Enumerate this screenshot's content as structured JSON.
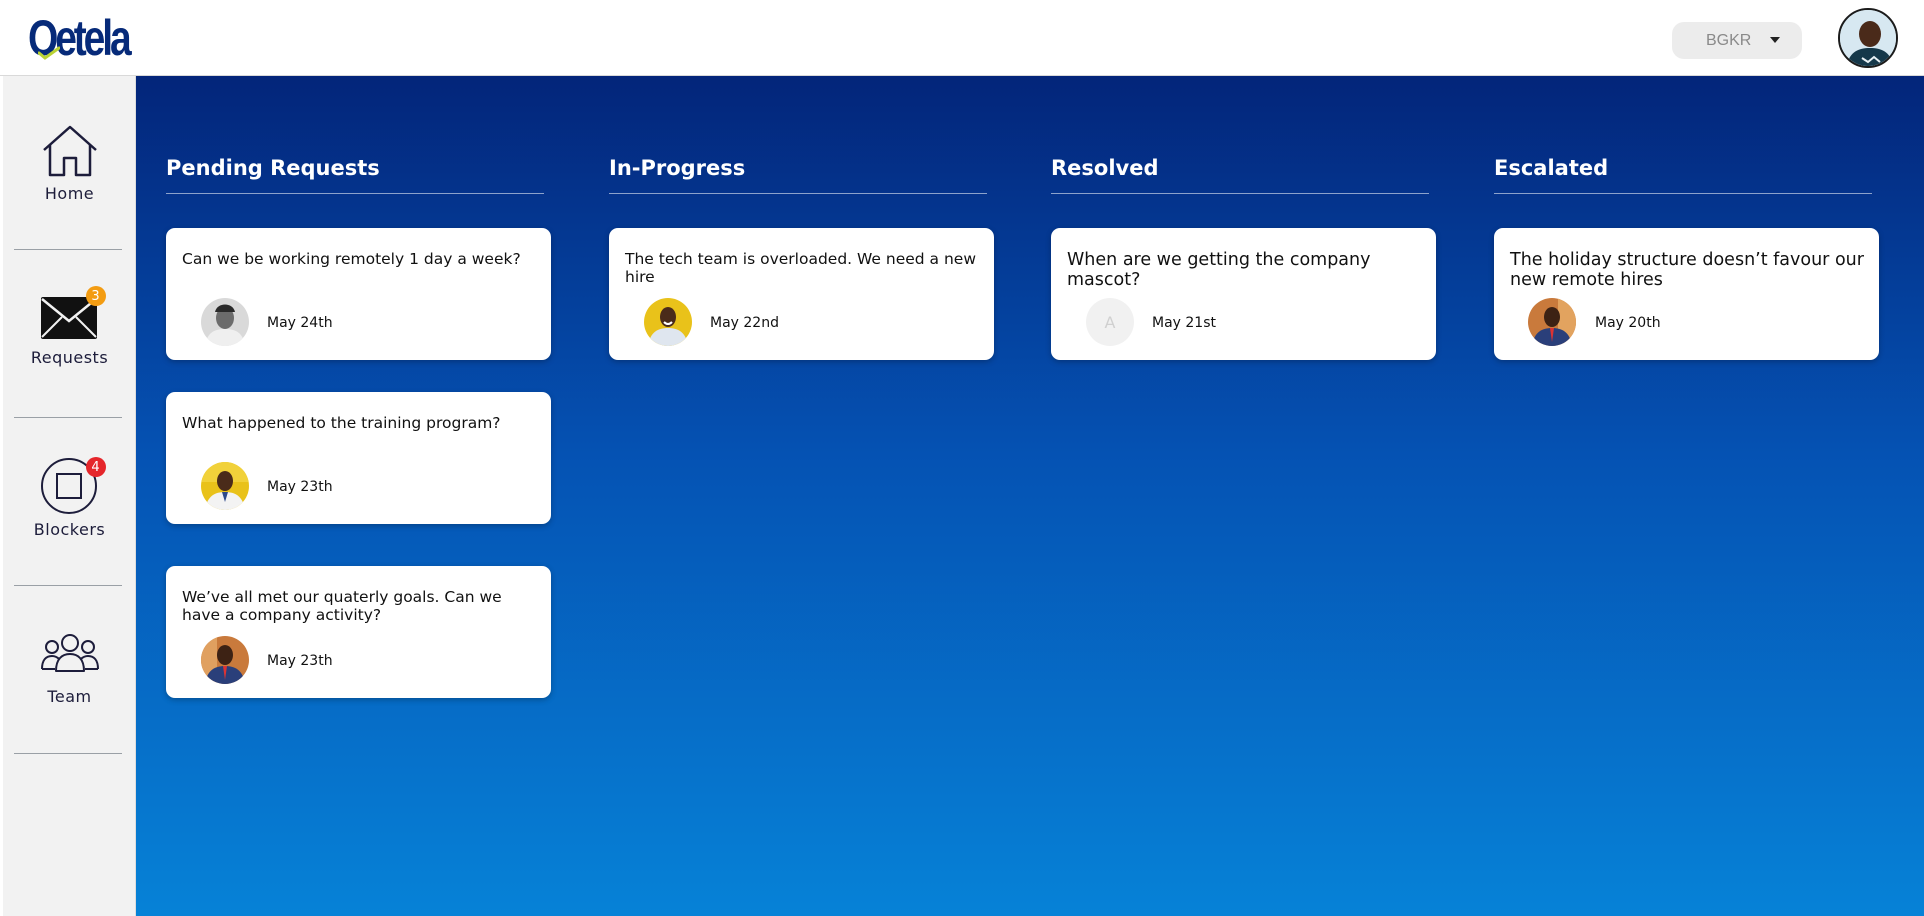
{
  "brand": {
    "logo_text": "Oetela"
  },
  "header": {
    "org_select": {
      "value": "BGKR"
    }
  },
  "sidebar": {
    "items": [
      {
        "label": "Home",
        "icon": "home-icon"
      },
      {
        "label": "Requests",
        "icon": "envelope-icon",
        "badge": "3"
      },
      {
        "label": "Blockers",
        "icon": "blocker-icon",
        "badge": "4"
      },
      {
        "label": "Team",
        "icon": "team-icon"
      }
    ]
  },
  "board": {
    "columns": [
      {
        "title": "Pending Requests",
        "cards": [
          {
            "text": "Can we be working remotely 1 day a week?",
            "date": "May 24th"
          },
          {
            "text": "What happened to the training program?",
            "date": "May 23th"
          },
          {
            "text": "We’ve all met our quaterly goals. Can we have a company activity?",
            "date": "May 23th"
          }
        ]
      },
      {
        "title": "In-Progress",
        "cards": [
          {
            "text": "The tech team is overloaded. We need a new hire",
            "date": "May 22nd"
          }
        ]
      },
      {
        "title": "Resolved",
        "cards": [
          {
            "text": "When are we getting the company mascot?",
            "date": "May 21st",
            "avatar_initial": "A"
          }
        ]
      },
      {
        "title": "Escalated",
        "cards": [
          {
            "text": "The holiday structure doesn’t favour our new remote hires",
            "date": "May 20th"
          }
        ]
      }
    ]
  },
  "colors": {
    "brand_navy": "#062a79",
    "badge_orange": "#f39c12",
    "badge_red": "#e5262b",
    "board_top": "#03257a",
    "board_bottom": "#0682d7"
  }
}
